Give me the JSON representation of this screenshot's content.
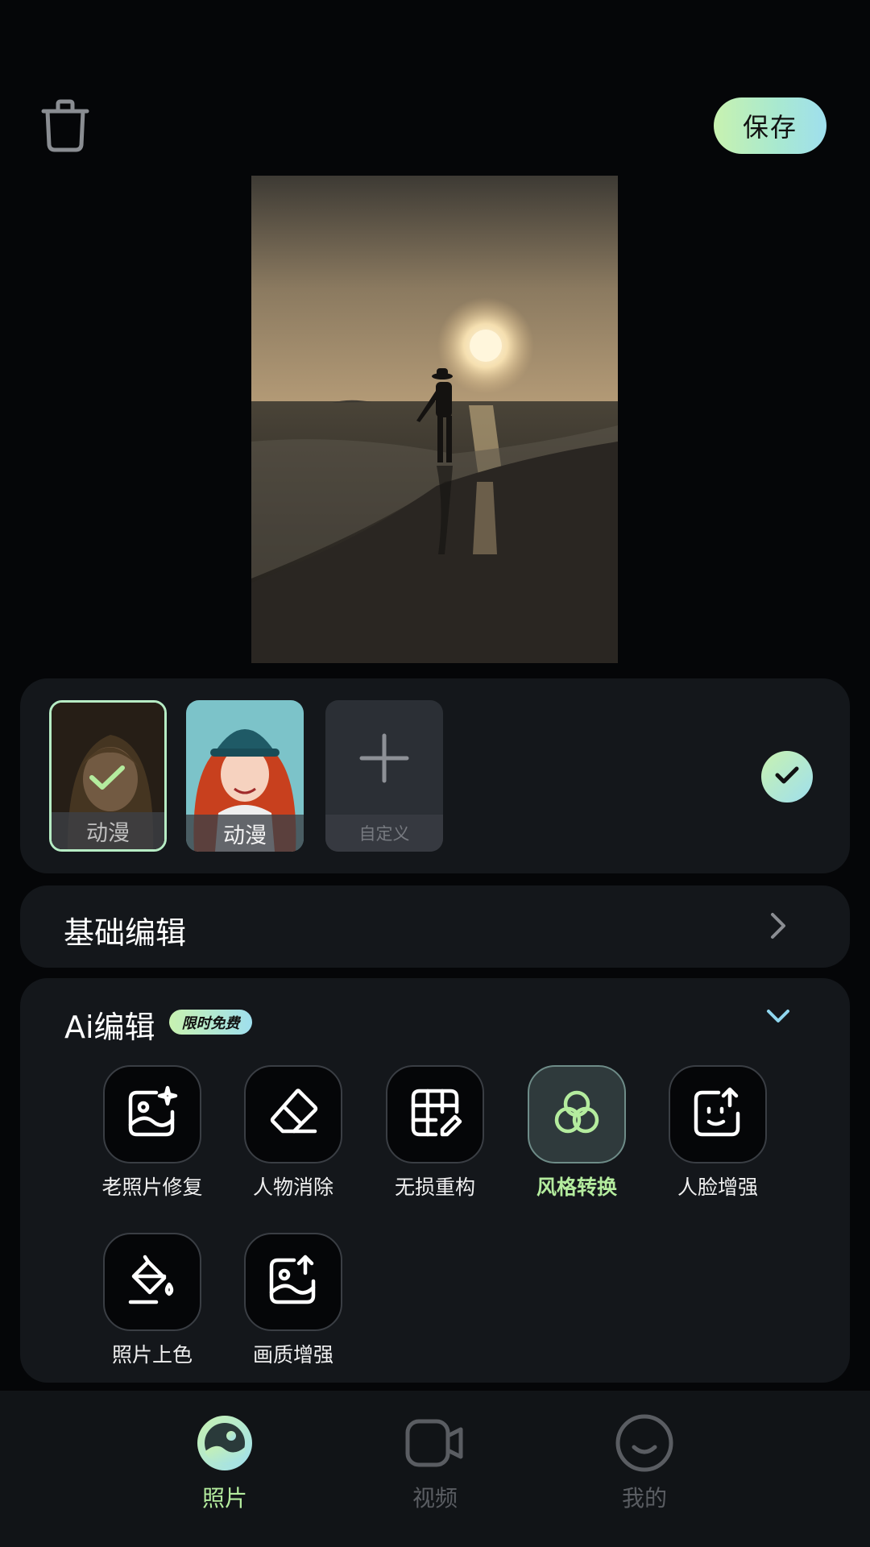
{
  "header": {
    "delete_icon": "trash-icon",
    "save_label": "保存"
  },
  "styles": {
    "items": [
      {
        "label": "动漫",
        "selected": true
      },
      {
        "label": "动漫",
        "selected": false
      },
      {
        "label": "自定义",
        "icon": "plus-icon"
      }
    ],
    "confirm_icon": "check-icon"
  },
  "basic_edit": {
    "title": "基础编辑",
    "icon": "chevron-right-icon"
  },
  "ai_edit": {
    "title": "Ai编辑",
    "badge": "限时免费",
    "icon": "chevron-down-icon",
    "tools": [
      {
        "label": "老照片修复",
        "icon": "photo-sparkle-icon"
      },
      {
        "label": "人物消除",
        "icon": "eraser-icon"
      },
      {
        "label": "无损重构",
        "icon": "grid-edit-icon"
      },
      {
        "label": "风格转换",
        "icon": "style-circles-icon",
        "active": true
      },
      {
        "label": "人脸增强",
        "icon": "face-upload-icon"
      },
      {
        "label": "照片上色",
        "icon": "paint-bucket-icon"
      },
      {
        "label": "画质增强",
        "icon": "image-upload-icon"
      }
    ]
  },
  "nav": {
    "items": [
      {
        "label": "照片",
        "icon": "photo-icon",
        "active": true
      },
      {
        "label": "视频",
        "icon": "video-icon"
      },
      {
        "label": "我的",
        "icon": "smile-icon"
      }
    ]
  },
  "colors": {
    "accent_green": "#b4ec9e",
    "accent_gradient_start": "#c8f2b0",
    "accent_gradient_end": "#9fdfee",
    "panel": "#14171b",
    "background": "#050608"
  }
}
